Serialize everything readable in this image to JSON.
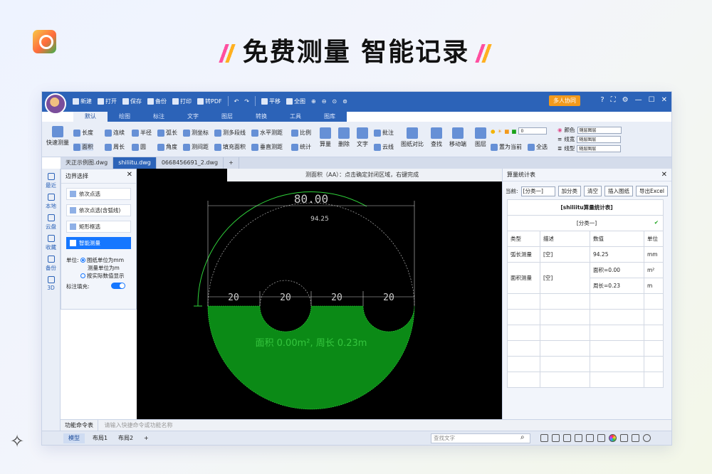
{
  "headline": "免费测量 智能记录",
  "quick_access": [
    "新建",
    "打开",
    "保存",
    "备份",
    "打印",
    "转PDF",
    "平移",
    "全图"
  ],
  "collab": "多人协同",
  "menu_tabs": [
    "默认",
    "绘图",
    "标注",
    "文字",
    "图层",
    "转换",
    "工具",
    "图库"
  ],
  "ribbon": {
    "quick_measure": "快速测量",
    "length": "长度",
    "area": "面积",
    "continuous": "连续",
    "perimeter": "周长",
    "radius": "半径",
    "circle": "圆",
    "arc": "弧长",
    "angle": "角度",
    "coord": "测坐标",
    "gap": "测间距",
    "polyline": "测多段线",
    "fill_area": "填充面积",
    "hdist": "水平测距",
    "vdist": "垂直测距",
    "scale": "比例",
    "stats": "统计",
    "calc": "算量",
    "delete": "删除",
    "text": "文字",
    "note": "批注",
    "cloud": "云线",
    "compare": "图纸对比",
    "find": "查找",
    "mobile": "移动端",
    "layer": "图层",
    "set_current": "置为当前",
    "select_all": "全选",
    "layer_value": "0",
    "color": "颜色",
    "linewidth": "线宽",
    "linetype": "线型",
    "by_layer": "随层图层"
  },
  "doc_tabs": [
    "天正示例图.dwg",
    "shiliitu.dwg",
    "0668456691_2.dwg"
  ],
  "left_bar": [
    "最近",
    "本地",
    "云盘",
    "收藏",
    "备份",
    "3D"
  ],
  "panel": {
    "title": "边界选择",
    "options": [
      "依次点选",
      "依次点选(含弧线)",
      "矩形框选",
      "智能测量"
    ],
    "unit_label": "单位:",
    "unit_opt1": "图纸单位为mm",
    "unit_opt1b": "测量单位为m",
    "unit_opt2": "按实际数值显示",
    "fill_label": "标注填充:"
  },
  "hint": "测面积（AA）：点击确定封闭区域，右键完成",
  "drawing": {
    "dim_top": "80.00",
    "dim_arc": "94.25",
    "dims_bottom": [
      "20",
      "20",
      "20",
      "20"
    ],
    "area_text": "面积 0.00m², 周长 0.23m",
    "fill_color": "#0b8a16"
  },
  "stat_panel": {
    "title": "算量统计表",
    "current_label": "当前:",
    "current_value": "[分类一]",
    "btn_add": "加分类",
    "btn_clear": "清空",
    "btn_insert": "插入图纸",
    "btn_export": "导出Excel",
    "table_title": "[shiliitu算量统计表]",
    "category": "[分类一]",
    "headers": [
      "类型",
      "描述",
      "数值",
      "单位"
    ],
    "rows": [
      {
        "type": "弧长测量",
        "desc": "[空]",
        "value": "94.25",
        "unit": "mm"
      },
      {
        "type": "面积测量",
        "desc": "[空]",
        "value": "面积=0.00",
        "unit": "m²"
      },
      {
        "type": "",
        "desc": "",
        "value": "周长=0.23",
        "unit": "m"
      }
    ]
  },
  "cmd_label": "功能命令表",
  "cmd_placeholder": "请输入快捷命令或功能名称",
  "layouts": [
    "模型",
    "布局1",
    "布局2",
    "+"
  ],
  "find_placeholder": "查找文字"
}
